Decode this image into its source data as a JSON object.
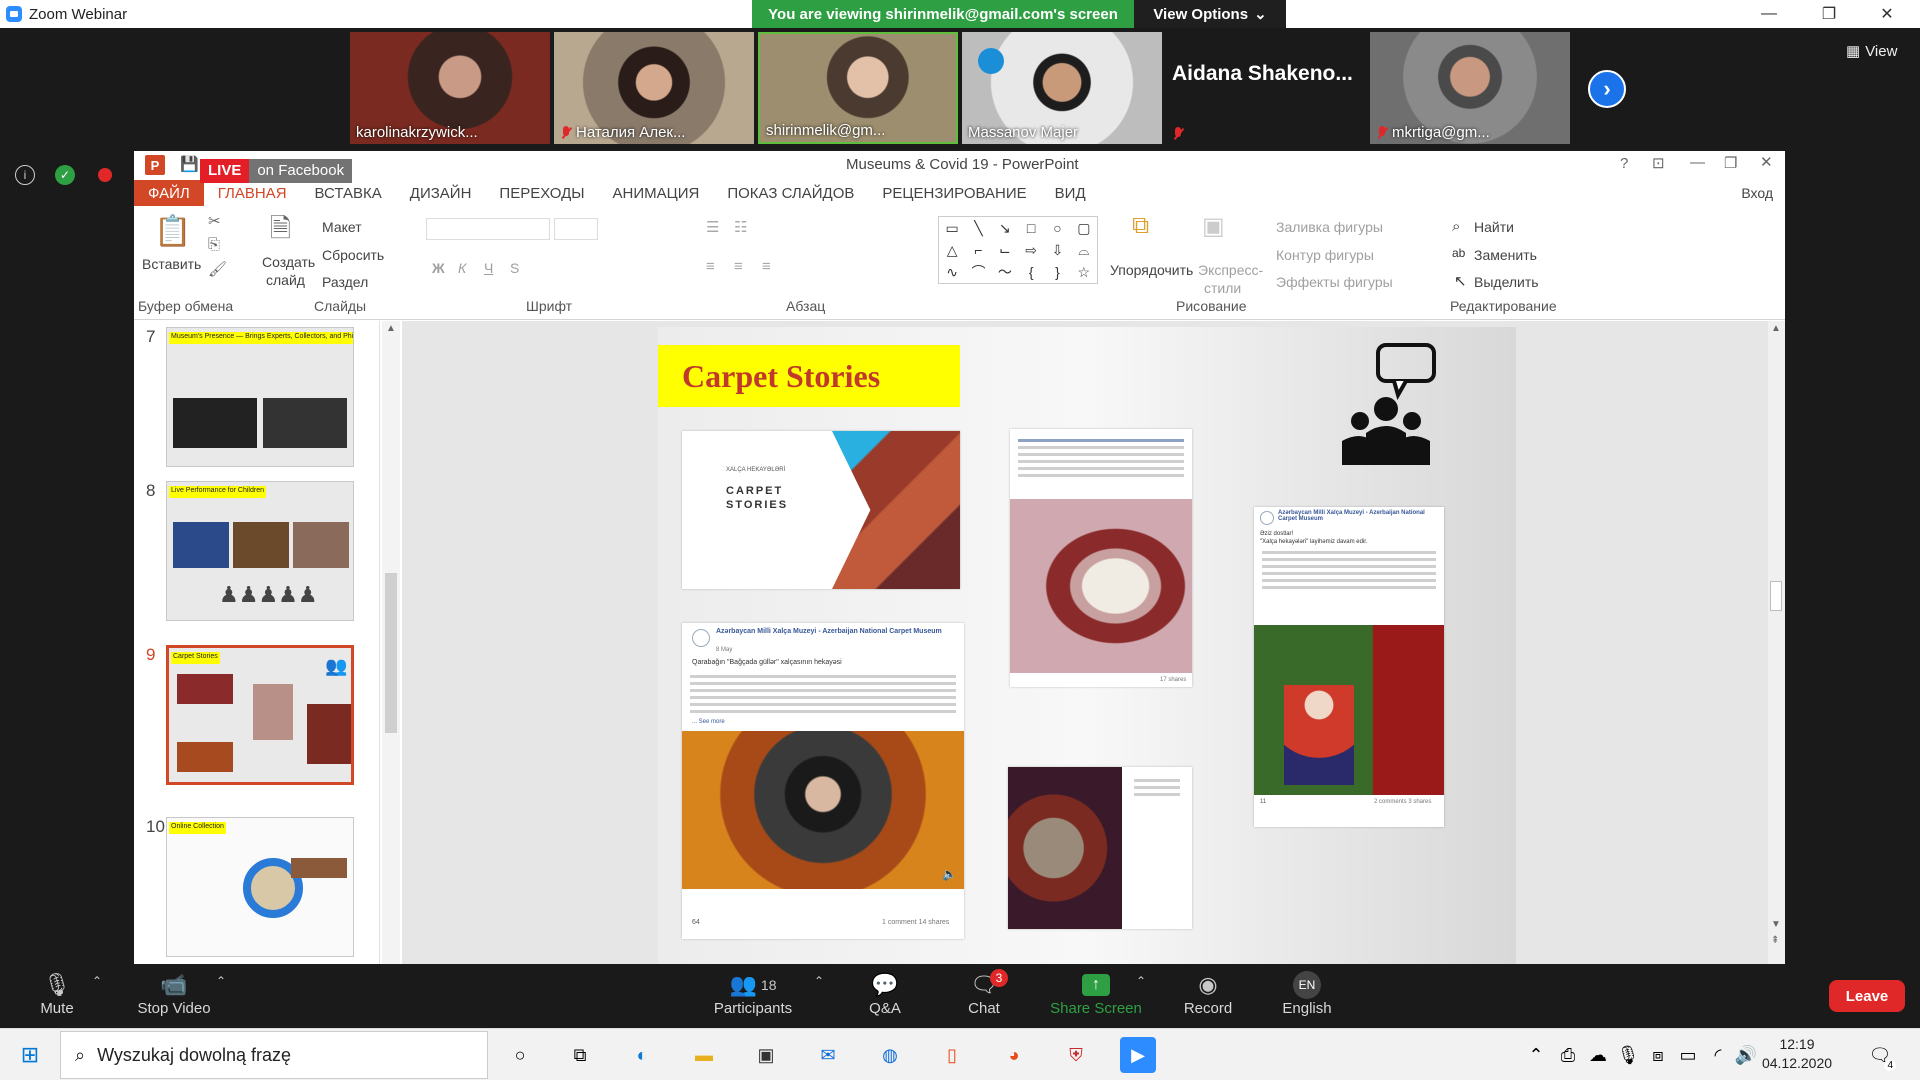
{
  "window": {
    "title": "Zoom Webinar",
    "minimize": "—",
    "restore": "❐",
    "close": "✕"
  },
  "banner": {
    "viewing_text": "You are viewing shirinmelik@gmail.com's screen",
    "view_options": "View Options"
  },
  "gallery": {
    "participants": [
      {
        "name": "karolinakrzywick...",
        "muted": false
      },
      {
        "name": "Наталия Алек...",
        "muted": true
      },
      {
        "name": "shirinmelik@gm...",
        "muted": false
      },
      {
        "name": "Massanov Majer",
        "muted": false
      },
      {
        "name": "Aidana Shakeno...",
        "muted": true,
        "name_only": true
      },
      {
        "name": "mkrtiga@gm...",
        "muted": true
      }
    ],
    "view_label": "View"
  },
  "live": {
    "live": "LIVE",
    "on": "on Facebook"
  },
  "ppt": {
    "title": "Museums & Covid 19 - PowerPoint",
    "tabs": [
      "ФАЙЛ",
      "ГЛАВНАЯ",
      "ВСТАВКА",
      "ДИЗАЙН",
      "ПЕРЕХОДЫ",
      "АНИМАЦИЯ",
      "ПОКАЗ СЛАЙДОВ",
      "РЕЦЕНЗИРОВАНИЕ",
      "ВИД"
    ],
    "login": "Вход",
    "ribbon": {
      "paste": "Вставить",
      "clipboard": "Буфер обмена",
      "new_slide": "Создать",
      "new_slide2": "слайд",
      "layout": "Макет",
      "reset": "Сбросить",
      "section": "Раздел",
      "slides": "Слайды",
      "font": "Шрифт",
      "paragraph": "Абзац",
      "arrange": "Упорядочить",
      "quick_styles": "Экспресс-",
      "quick_styles2": "стили",
      "shape_fill": "Заливка фигуры",
      "shape_outline": "Контур фигуры",
      "shape_effects": "Эффекты фигуры",
      "drawing": "Рисование",
      "find": "Найти",
      "replace": "Заменить",
      "select": "Выделить",
      "editing": "Редактирование",
      "bold": "Ж",
      "italic": "К",
      "underline": "Ч",
      "strike": "S"
    },
    "thumbnails": [
      {
        "num": "7",
        "header": "Museum's Presence — Brings Experts, Collectors, and Philanthropists"
      },
      {
        "num": "8",
        "header": "Live Performance for Children"
      },
      {
        "num": "9",
        "header": "Carpet Stories",
        "selected": true
      },
      {
        "num": "10",
        "header": "Online Collection"
      }
    ],
    "slide": {
      "title": "Carpet Stories",
      "cover_line1": "XALÇA HEKAYƏLƏRİ",
      "cover_line2": "CARPET",
      "cover_line3": "STORIES",
      "post_author": "Azərbaycan Milli Xalça Muzeyi - Azerbaijan National Carpet Museum",
      "post_date": "8 May",
      "post_intro": "Qarabağın \"Bağçada güllər\" xalçasının hekayəsi",
      "see_more": "... See more",
      "post_footer": "1 comment  14 shares",
      "post2_footer": "17 shares",
      "post3_greet": "Əziz dostlar!",
      "post3_sub": "\"Xalça hekayələri\" layihəmiz davam edir.",
      "post3_footer": "2 comments  3 shares",
      "reactions": "64",
      "reactions3": "11"
    }
  },
  "toolbar": {
    "mute": "Mute",
    "stop_video": "Stop Video",
    "participants": "Participants",
    "participants_count": "18",
    "qa": "Q&A",
    "chat": "Chat",
    "chat_badge": "3",
    "share": "Share Screen",
    "record": "Record",
    "english": "English",
    "lang_code": "EN",
    "leave": "Leave"
  },
  "taskbar": {
    "search_placeholder": "Wyszukaj dowolną frazę",
    "time": "12:19",
    "date": "04.12.2020",
    "notif_count": "4"
  },
  "colors": {
    "zoom_green": "#2ea043",
    "ppt_orange": "#d24726",
    "leave_red": "#e02828",
    "slide_yellow": "#ffff00"
  }
}
